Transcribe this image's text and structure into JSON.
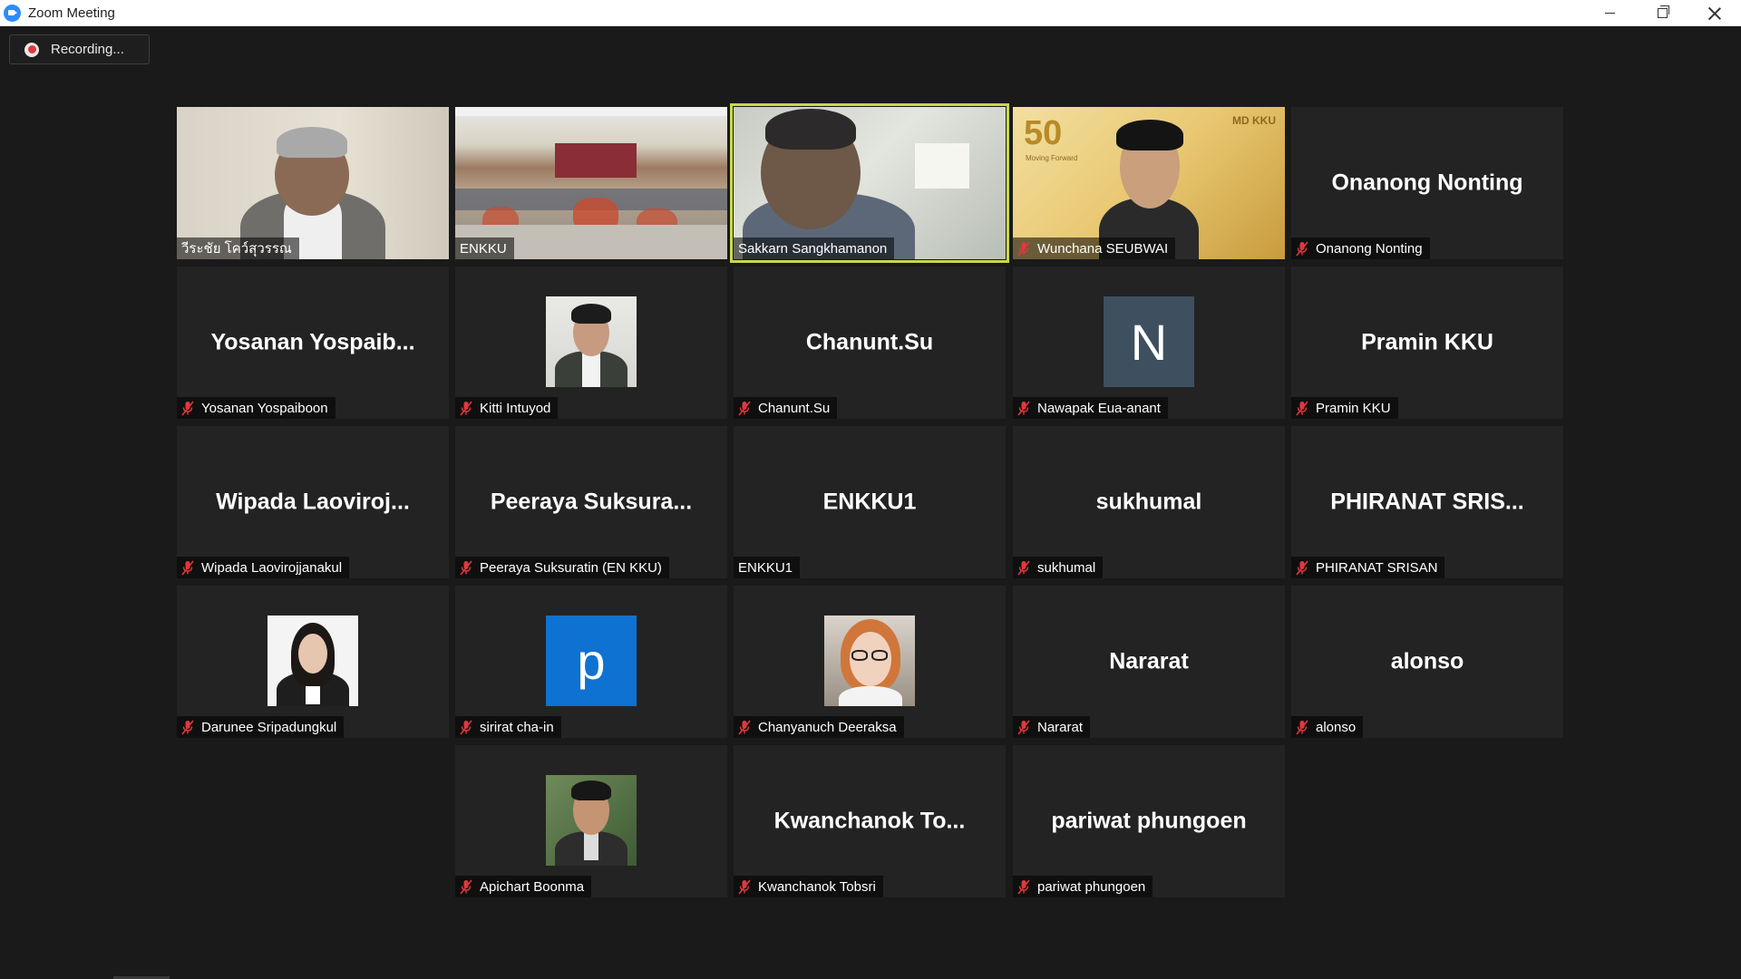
{
  "window": {
    "title": "Zoom Meeting"
  },
  "recording": {
    "label": "Recording..."
  },
  "colors": {
    "active_speaker": "#c9d84a",
    "tile_bg": "#232323",
    "mute": "#e0383e",
    "avatar_blue": "#0e72d2",
    "avatar_slate": "#3e4f5f"
  },
  "tiles": [
    {
      "id": "t1",
      "display": "",
      "label": "วีระชัย โคว์สุวรรณ",
      "muted": false,
      "kind": "video"
    },
    {
      "id": "t2",
      "display": "",
      "label": "ENKKU",
      "muted": false,
      "kind": "video"
    },
    {
      "id": "t3",
      "display": "",
      "label": "Sakkarn Sangkhamanon",
      "muted": false,
      "kind": "video",
      "active": true
    },
    {
      "id": "t4",
      "display": "",
      "label": "Wunchana SEUBWAI",
      "muted": true,
      "kind": "video",
      "banner_text": "50",
      "banner_sub": "Moving Forward",
      "logo_text": "MD KKU"
    },
    {
      "id": "t5",
      "display": "Onanong Nonting",
      "label": "Onanong Nonting",
      "muted": true,
      "kind": "name"
    },
    {
      "id": "t6",
      "display": "Yosanan  Yospaib...",
      "label": "Yosanan Yospaiboon",
      "muted": true,
      "kind": "name"
    },
    {
      "id": "t7",
      "display": "",
      "label": "Kitti Intuyod",
      "muted": true,
      "kind": "photo"
    },
    {
      "id": "t8",
      "display": "Chanunt.Su",
      "label": "Chanunt.Su",
      "muted": true,
      "kind": "name"
    },
    {
      "id": "t9",
      "display": "",
      "label": "Nawapak Eua-anant",
      "muted": true,
      "kind": "letter",
      "letter": "N"
    },
    {
      "id": "t10",
      "display": "Pramin KKU",
      "label": "Pramin KKU",
      "muted": true,
      "kind": "name"
    },
    {
      "id": "t11",
      "display": "Wipada  Laoviroj...",
      "label": "Wipada Laovirojjanakul",
      "muted": true,
      "kind": "name"
    },
    {
      "id": "t12",
      "display": "Peeraya  Suksura...",
      "label": "Peeraya Suksuratin (EN KKU)",
      "muted": true,
      "kind": "name"
    },
    {
      "id": "t13",
      "display": "ENKKU1",
      "label": "ENKKU1",
      "muted": false,
      "kind": "name"
    },
    {
      "id": "t14",
      "display": "sukhumal",
      "label": "sukhumal",
      "muted": true,
      "kind": "name"
    },
    {
      "id": "t15",
      "display": "PHIRANAT  SRIS...",
      "label": "PHIRANAT SRISAN",
      "muted": true,
      "kind": "name"
    },
    {
      "id": "t16",
      "display": "",
      "label": "Darunee Sripadungkul",
      "muted": true,
      "kind": "photo"
    },
    {
      "id": "t17",
      "display": "",
      "label": "sirirat cha-in",
      "muted": true,
      "kind": "letter",
      "letter": "p"
    },
    {
      "id": "t18",
      "display": "",
      "label": "Chanyanuch Deeraksa",
      "muted": true,
      "kind": "photo"
    },
    {
      "id": "t19",
      "display": "Nararat",
      "label": "Nararat",
      "muted": true,
      "kind": "name"
    },
    {
      "id": "t20",
      "display": "alonso",
      "label": "alonso",
      "muted": true,
      "kind": "name"
    },
    {
      "id": "t21",
      "display": "",
      "label": "Apichart Boonma",
      "muted": true,
      "kind": "photo"
    },
    {
      "id": "t22",
      "display": "Kwanchanok  To...",
      "label": "Kwanchanok Tobsri",
      "muted": true,
      "kind": "name"
    },
    {
      "id": "t23",
      "display": "pariwat phungoen",
      "label": "pariwat phungoen",
      "muted": true,
      "kind": "name"
    }
  ]
}
